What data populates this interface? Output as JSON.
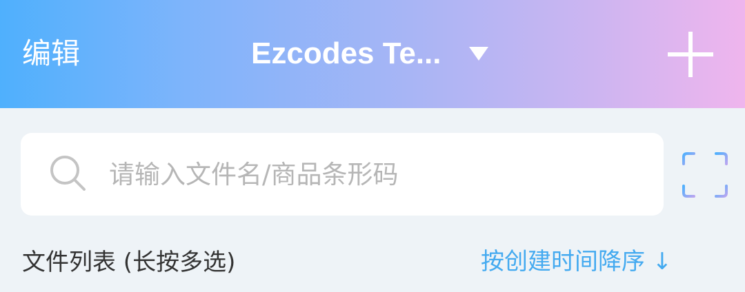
{
  "header": {
    "edit_label": "编辑",
    "title": "Ezcodes Te...",
    "title_icon": "caret-down-icon",
    "add_icon": "plus-icon",
    "gradient": [
      "#4fb0fd",
      "#efb5ed"
    ]
  },
  "search": {
    "placeholder": "请输入文件名/商品条形码",
    "value": "",
    "search_icon": "search-icon",
    "scan_icon": "scan-icon"
  },
  "file_list": {
    "label": "文件列表 (长按多选)",
    "sort_label": "按创建时间降序 ↓"
  },
  "colors": {
    "accent": "#44aaf0",
    "background": "#eef3f7"
  }
}
